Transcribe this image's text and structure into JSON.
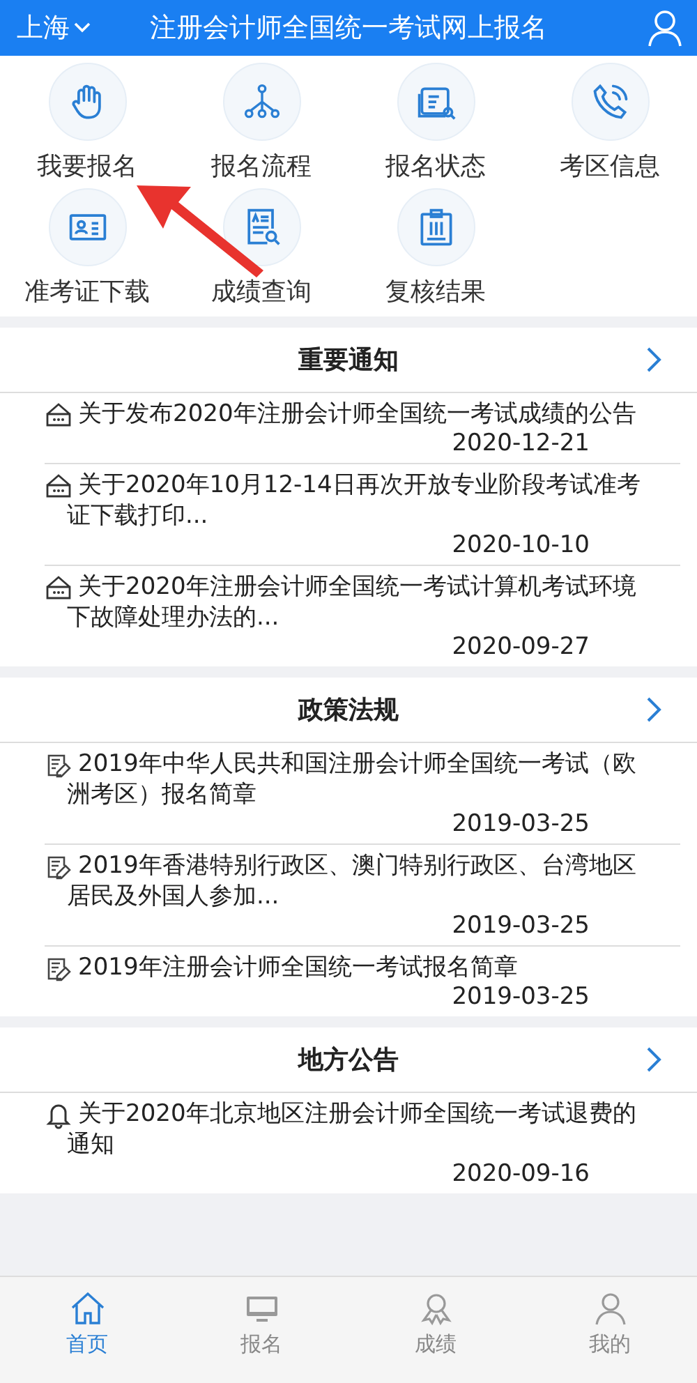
{
  "header": {
    "city": "上海",
    "title": "注册会计师全国统一考试网上报名"
  },
  "shortcuts": [
    {
      "label": "我要报名",
      "kind": "hand"
    },
    {
      "label": "报名流程",
      "kind": "flow"
    },
    {
      "label": "报名状态",
      "kind": "status"
    },
    {
      "label": "考区信息",
      "kind": "phone"
    },
    {
      "label": "准考证下载",
      "kind": "card"
    },
    {
      "label": "成绩查询",
      "kind": "search"
    },
    {
      "label": "复核结果",
      "kind": "clipboard"
    }
  ],
  "sections": [
    {
      "title": "重要通知",
      "kind": "notice",
      "items": [
        {
          "title": "关于发布2020年注册会计师全国统一考试成绩的公告",
          "date": "2020-12-21"
        },
        {
          "title": "关于2020年10月12-14日再次开放专业阶段考试准考证下载打印...",
          "date": "2020-10-10"
        },
        {
          "title": "关于2020年注册会计师全国统一考试计算机考试环境下故障处理办法的...",
          "date": "2020-09-27"
        }
      ]
    },
    {
      "title": "政策法规",
      "kind": "policy",
      "items": [
        {
          "title": "2019年中华人民共和国注册会计师全国统一考试（欧洲考区）报名简章",
          "date": "2019-03-25"
        },
        {
          "title": "2019年香港特别行政区、澳门特别行政区、台湾地区居民及外国人参加...",
          "date": "2019-03-25"
        },
        {
          "title": "2019年注册会计师全国统一考试报名简章",
          "date": "2019-03-25"
        }
      ]
    },
    {
      "title": "地方公告",
      "kind": "bell",
      "items": [
        {
          "title": "关于2020年北京地区注册会计师全国统一考试退费的通知",
          "date": "2020-09-16"
        }
      ]
    }
  ],
  "tabbar": [
    {
      "label": "首页",
      "kind": "home",
      "selected": true
    },
    {
      "label": "报名",
      "kind": "monitor",
      "selected": false
    },
    {
      "label": "成绩",
      "kind": "award",
      "selected": false
    },
    {
      "label": "我的",
      "kind": "person",
      "selected": false
    }
  ]
}
